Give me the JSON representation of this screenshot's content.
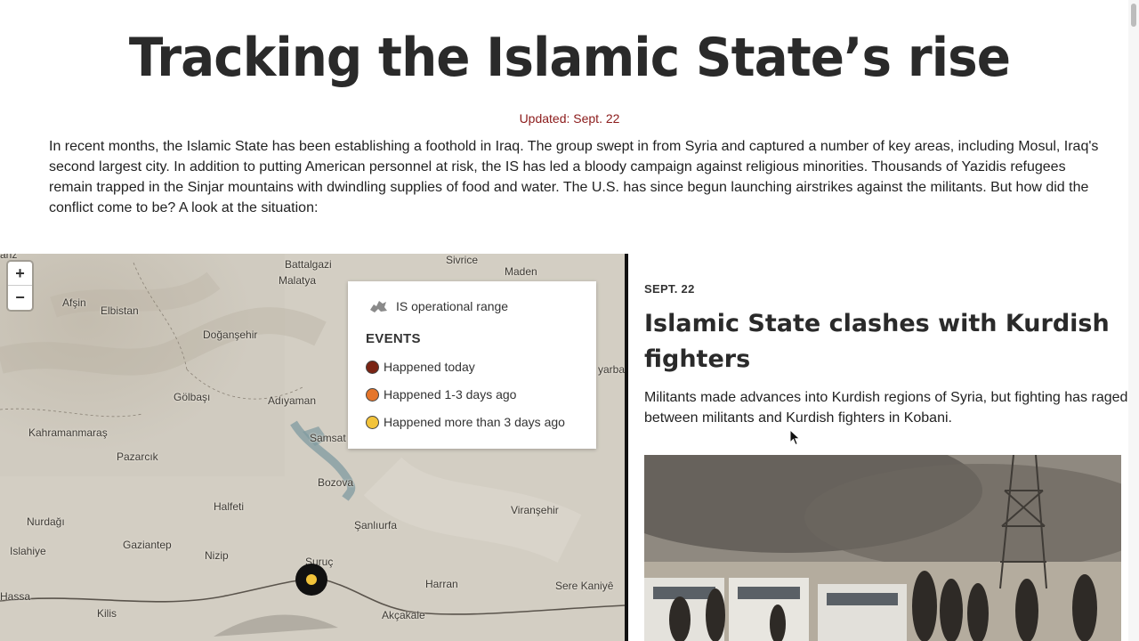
{
  "header": {
    "title": "Tracking the Islamic State’s rise",
    "updated": "Updated: Sept. 22",
    "intro": "In recent months, the Islamic State has been establishing a foothold in Iraq. The group swept in from Syria and captured a number of key areas, including Mosul, Iraq's second largest city. In addition to putting American personnel at risk, the IS has led a bloody campaign against religious minorities. Thousands of Yazidis refugees remain trapped in the Sinjar mountains with dwindling supplies of food and water. The U.S. has since begun launching airstrikes against the militants. But how did the conflict come to be? A look at the situation:"
  },
  "map": {
    "zoom_in": "+",
    "zoom_out": "−",
    "places": [
      "Battalgazi",
      "Malatya",
      "Sivrice",
      "Maden",
      "Afşin",
      "Elbistan",
      "Doğanşehir",
      "Gölbaşı",
      "Adıyaman",
      "Kahramanmaraş",
      "Pazarcık",
      "Samsat",
      "Bozova",
      "Halfeti",
      "Şanlıurfa",
      "Viranşehir",
      "Nurdağı",
      "Gaziantep",
      "Islahiye",
      "Nizip",
      "Suruç",
      "Harran",
      "Hassa",
      "Kilis",
      "Akçakale",
      "Sere Kaniyê",
      "yarba",
      "anz"
    ],
    "legend": {
      "range_label": "IS operational range",
      "events_title": "EVENTS",
      "events": [
        {
          "label": "Happened today",
          "color": "#7a2414"
        },
        {
          "label": "Happened 1-3 days ago",
          "color": "#e5752a"
        },
        {
          "label": "Happened more than 3 days ago",
          "color": "#f2c33a"
        }
      ]
    },
    "marker_color": "#f2c33a"
  },
  "article": {
    "date": "SEPT. 22",
    "headline": "Islamic State clashes with Kurdish fighters",
    "body": "Militants made advances into Kurdish regions of Syria, but fighting has raged between militants and Kurdish fighters in Kobani."
  }
}
